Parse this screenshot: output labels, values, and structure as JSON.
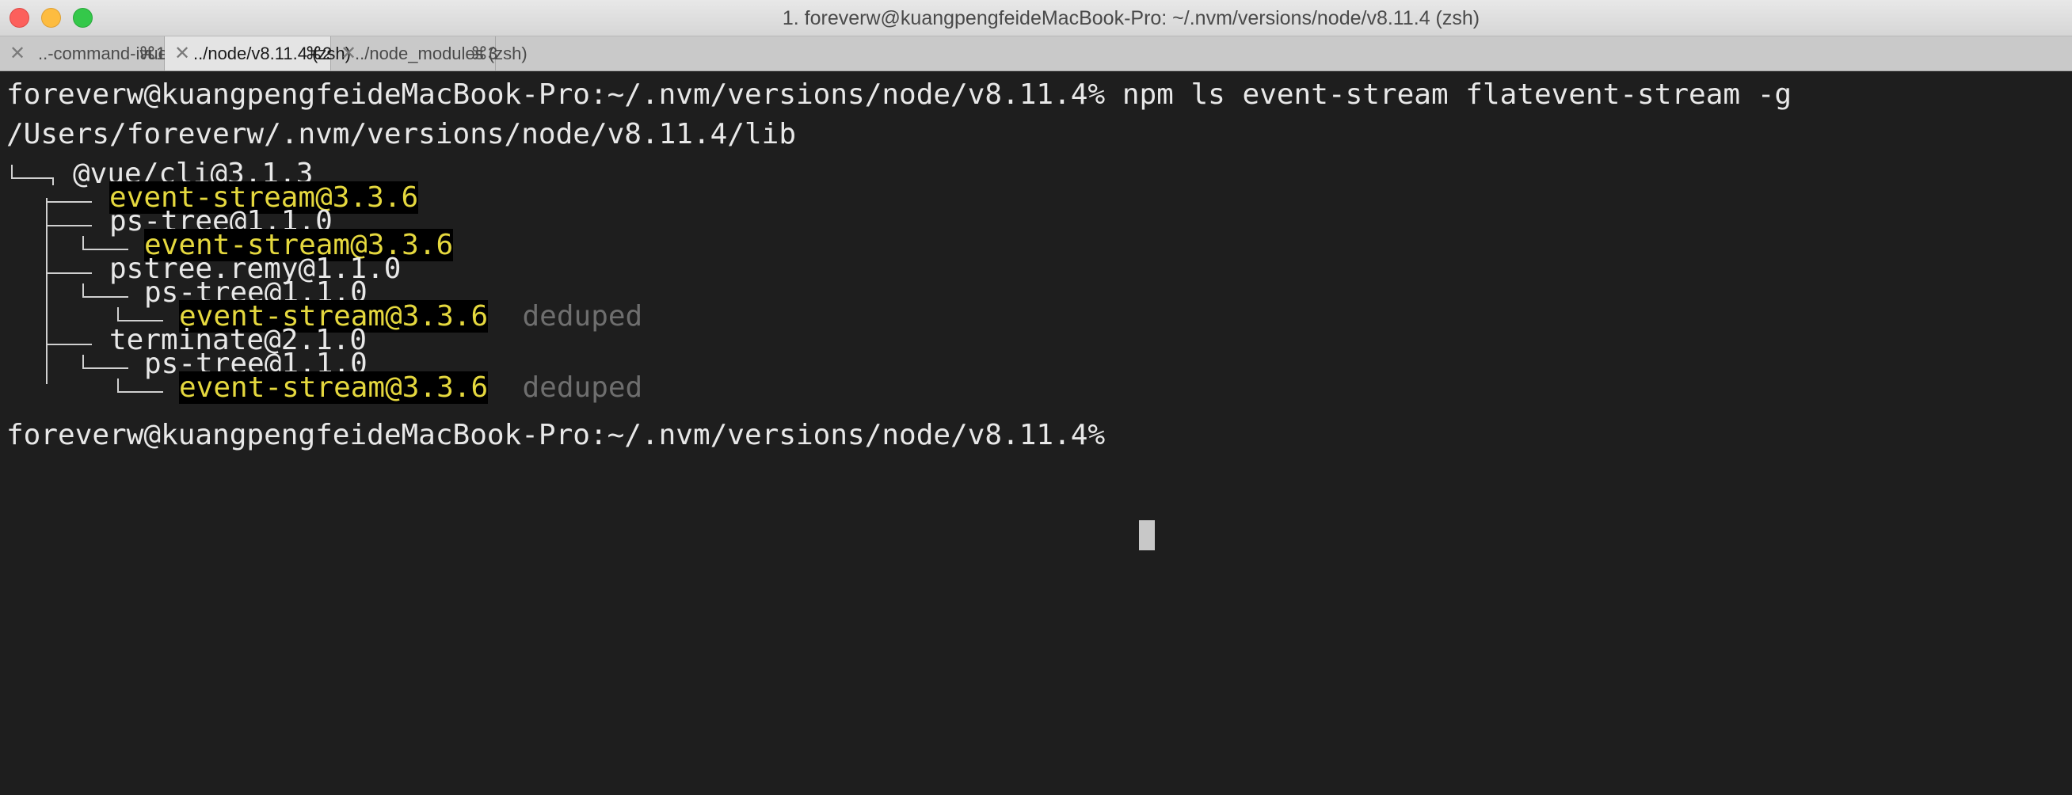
{
  "window": {
    "title": "1. foreverw@kuangpengfeideMacBook-Pro: ~/.nvm/versions/node/v8.11.4 (zsh)"
  },
  "tabs": [
    {
      "label": "..-command-ivue (zsh)",
      "shortcut": "⌘1",
      "active": false
    },
    {
      "label": "../node/v8.11.4 (zsh)",
      "shortcut": "⌘2",
      "active": true
    },
    {
      "label": "../node_modules (zsh)",
      "shortcut": "⌘3",
      "active": false
    }
  ],
  "terminal": {
    "prompt": "foreverw@kuangpengfeideMacBook-Pro:~/.nvm/versions/node/v8.11.4%",
    "command": "npm ls event-stream flatevent-stream -g",
    "lib_path": "/Users/foreverw/.nvm/versions/node/v8.11.4/lib",
    "tree": {
      "root": "@vue/cli@3.1.3",
      "event_stream_1": "event-stream@3.3.6",
      "ps_tree_1": "ps-tree@1.1.0",
      "event_stream_2": "event-stream@3.3.6",
      "pstree_remy": "pstree.remy@1.1.0",
      "ps_tree_2": "ps-tree@1.1.0",
      "event_stream_3": "event-stream@3.3.6",
      "deduped_1": "deduped",
      "terminate": "terminate@2.1.0",
      "ps_tree_3": "ps-tree@1.1.0",
      "event_stream_4": "event-stream@3.3.6",
      "deduped_2": "deduped"
    },
    "final_prompt": "foreverw@kuangpengfeideMacBook-Pro:~/.nvm/versions/node/v8.11.4%"
  },
  "colors": {
    "highlight_fg": "#e5d83e",
    "highlight_bg": "#000000",
    "terminal_bg": "#1e1e1e",
    "terminal_fg": "#e8e8e8",
    "dim": "#6e6e6e"
  }
}
